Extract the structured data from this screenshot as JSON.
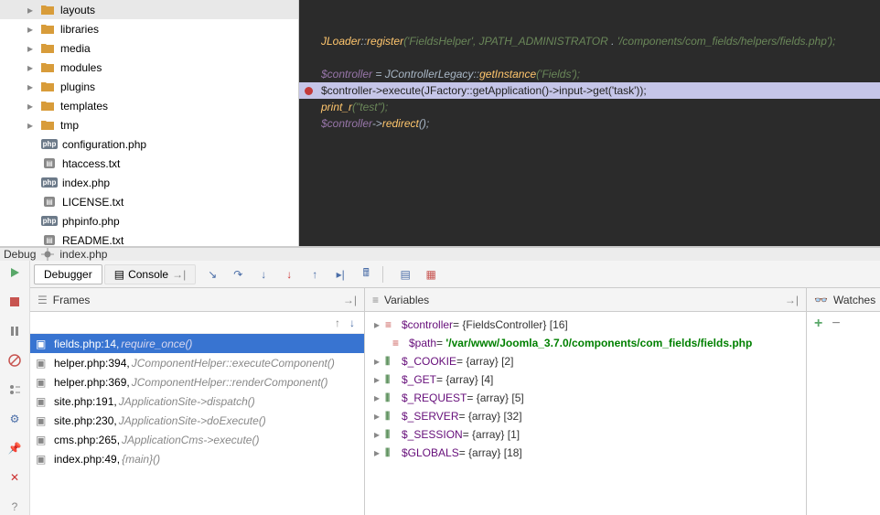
{
  "tree": {
    "folders": [
      "layouts",
      "libraries",
      "media",
      "modules",
      "plugins",
      "templates",
      "tmp"
    ],
    "files": [
      {
        "name": "configuration.php",
        "type": "php"
      },
      {
        "name": "htaccess.txt",
        "type": "txt"
      },
      {
        "name": "index.php",
        "type": "php"
      },
      {
        "name": "LICENSE.txt",
        "type": "txt"
      },
      {
        "name": "phpinfo.php",
        "type": "php"
      },
      {
        "name": "README.txt",
        "type": "txt"
      }
    ]
  },
  "code": {
    "line1_a": "JLoader",
    "line1_b": "register",
    "line1_c": "('FieldsHelper', JPATH_ADMINISTRATOR ",
    "line1_d": " '/components/com_fields/helpers/fields.php');",
    "blank": "",
    "line3_a": "$controller ",
    "line3_b": "= JControllerLegacy",
    "line3_c": "getInstance",
    "line3_d": "('Fields');",
    "line4": "$controller->execute(JFactory::getApplication()->input->get('task'));",
    "line5_a": "print_r",
    "line5_b": "(\"test\");",
    "line6_a": "$controller",
    "line6_b": "->",
    "line6_c": "redirect",
    "line6_d": "();"
  },
  "debug_tab": "Debug",
  "debug_file": "index.php",
  "tabs": {
    "debugger": "Debugger",
    "console": "Console"
  },
  "frames": {
    "title": "Frames",
    "items": [
      {
        "file": "fields.php:14,",
        "ctx": "require_once()",
        "sel": true
      },
      {
        "file": "helper.php:394,",
        "ctx": "JComponentHelper::executeComponent()"
      },
      {
        "file": "helper.php:369,",
        "ctx": "JComponentHelper::renderComponent()"
      },
      {
        "file": "site.php:191,",
        "ctx": "JApplicationSite->dispatch()"
      },
      {
        "file": "site.php:230,",
        "ctx": "JApplicationSite->doExecute()"
      },
      {
        "file": "cms.php:265,",
        "ctx": "JApplicationCms->execute()"
      },
      {
        "file": "index.php:49,",
        "ctx": "{main}()"
      }
    ]
  },
  "vars": {
    "title": "Variables",
    "items": [
      {
        "name": "$controller",
        "val": " = {FieldsController} [16]",
        "type": "obj"
      },
      {
        "name": "$path",
        "val": " = ",
        "green": "'/var/www/Joomla_3.7.0/components/com_fields/fields.php",
        "type": "obj",
        "indent": true
      },
      {
        "name": "$_COOKIE",
        "val": " = {array} [2]",
        "type": "arr"
      },
      {
        "name": "$_GET",
        "val": " = {array} [4]",
        "type": "arr"
      },
      {
        "name": "$_REQUEST",
        "val": " = {array} [5]",
        "type": "arr"
      },
      {
        "name": "$_SERVER",
        "val": " = {array} [32]",
        "type": "arr"
      },
      {
        "name": "$_SESSION",
        "val": " = {array} [1]",
        "type": "arr"
      },
      {
        "name": "$GLOBALS",
        "val": " = {array} [18]",
        "type": "arr"
      }
    ]
  },
  "watches": {
    "title": "Watches"
  }
}
